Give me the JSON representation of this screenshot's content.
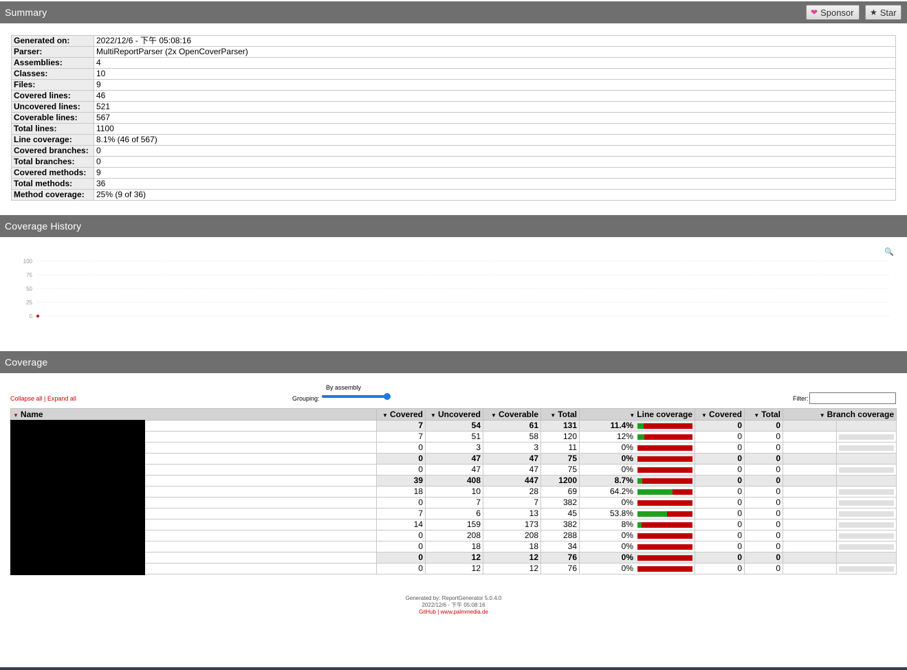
{
  "header": {
    "summary_title": "Summary",
    "sponsor_label": "Sponsor",
    "star_label": "Star",
    "history_title": "Coverage History",
    "coverage_title": "Coverage"
  },
  "summary": [
    {
      "key": "Generated on:",
      "value": "2022/12/6 - 下午 05:08:16"
    },
    {
      "key": "Parser:",
      "value": "MultiReportParser (2x OpenCoverParser)"
    },
    {
      "key": "Assemblies:",
      "value": "4"
    },
    {
      "key": "Classes:",
      "value": "10"
    },
    {
      "key": "Files:",
      "value": "9"
    },
    {
      "key": "Covered lines:",
      "value": "46"
    },
    {
      "key": "Uncovered lines:",
      "value": "521"
    },
    {
      "key": "Coverable lines:",
      "value": "567"
    },
    {
      "key": "Total lines:",
      "value": "1100"
    },
    {
      "key": "Line coverage:",
      "value": "8.1% (46 of 567)"
    },
    {
      "key": "Covered branches:",
      "value": "0"
    },
    {
      "key": "Total branches:",
      "value": "0"
    },
    {
      "key": "Covered methods:",
      "value": "9"
    },
    {
      "key": "Total methods:",
      "value": "36"
    },
    {
      "key": "Method coverage:",
      "value": "25% (9 of 36)"
    }
  ],
  "history": {
    "y_ticks": [
      "100",
      "75",
      "50",
      "25",
      "0"
    ],
    "point_value": 0,
    "point_color": "#c00000"
  },
  "controls": {
    "collapse_all": "Collapse all",
    "separator": "|",
    "expand_all": "Expand all",
    "grouping_label": "Grouping:",
    "grouping_value": "By assembly",
    "filter_label": "Filter:",
    "filter_value": ""
  },
  "table": {
    "headers": [
      "Name",
      "Covered",
      "Uncovered",
      "Coverable",
      "Total",
      "Line coverage",
      "Covered",
      "Total",
      "Branch coverage"
    ],
    "rows": [
      {
        "type": "grp",
        "covered": "7",
        "uncovered": "54",
        "coverable": "61",
        "total": "131",
        "pct": "11.4%",
        "frac": 0.114,
        "bcov": "0",
        "btotal": "0"
      },
      {
        "type": "cls",
        "covered": "7",
        "uncovered": "51",
        "coverable": "58",
        "total": "120",
        "pct": "12%",
        "frac": 0.12,
        "bcov": "0",
        "btotal": "0"
      },
      {
        "type": "cls",
        "covered": "0",
        "uncovered": "3",
        "coverable": "3",
        "total": "11",
        "pct": "0%",
        "frac": 0,
        "bcov": "0",
        "btotal": "0"
      },
      {
        "type": "grp",
        "covered": "0",
        "uncovered": "47",
        "coverable": "47",
        "total": "75",
        "pct": "0%",
        "frac": 0,
        "bcov": "0",
        "btotal": "0"
      },
      {
        "type": "cls",
        "covered": "0",
        "uncovered": "47",
        "coverable": "47",
        "total": "75",
        "pct": "0%",
        "frac": 0,
        "bcov": "0",
        "btotal": "0"
      },
      {
        "type": "grp",
        "covered": "39",
        "uncovered": "408",
        "coverable": "447",
        "total": "1200",
        "pct": "8.7%",
        "frac": 0.087,
        "bcov": "0",
        "btotal": "0"
      },
      {
        "type": "cls",
        "covered": "18",
        "uncovered": "10",
        "coverable": "28",
        "total": "69",
        "pct": "64.2%",
        "frac": 0.642,
        "bcov": "0",
        "btotal": "0"
      },
      {
        "type": "cls",
        "covered": "0",
        "uncovered": "7",
        "coverable": "7",
        "total": "382",
        "pct": "0%",
        "frac": 0,
        "bcov": "0",
        "btotal": "0"
      },
      {
        "type": "cls",
        "covered": "7",
        "uncovered": "6",
        "coverable": "13",
        "total": "45",
        "pct": "53.8%",
        "frac": 0.538,
        "bcov": "0",
        "btotal": "0"
      },
      {
        "type": "cls",
        "covered": "14",
        "uncovered": "159",
        "coverable": "173",
        "total": "382",
        "pct": "8%",
        "frac": 0.08,
        "bcov": "0",
        "btotal": "0"
      },
      {
        "type": "cls",
        "covered": "0",
        "uncovered": "208",
        "coverable": "208",
        "total": "288",
        "pct": "0%",
        "frac": 0,
        "bcov": "0",
        "btotal": "0"
      },
      {
        "type": "cls",
        "covered": "0",
        "uncovered": "18",
        "coverable": "18",
        "total": "34",
        "pct": "0%",
        "frac": 0,
        "bcov": "0",
        "btotal": "0"
      },
      {
        "type": "grp",
        "covered": "0",
        "uncovered": "12",
        "coverable": "12",
        "total": "76",
        "pct": "0%",
        "frac": 0,
        "bcov": "0",
        "btotal": "0"
      },
      {
        "type": "cls",
        "covered": "0",
        "uncovered": "12",
        "coverable": "12",
        "total": "76",
        "pct": "0%",
        "frac": 0,
        "bcov": "0",
        "btotal": "0"
      }
    ]
  },
  "footer": {
    "generated_by": "Generated by: ReportGenerator 5.0.4.0",
    "date": "2022/12/6 - 下午 05:08:16",
    "github": "GitHub",
    "sep": "|",
    "site": "www.palmmedia.de"
  },
  "colors": {
    "header_bar": "#6f6f6f",
    "covered": "#1ea01e",
    "uncovered": "#c00000",
    "link": "#cc0000"
  }
}
